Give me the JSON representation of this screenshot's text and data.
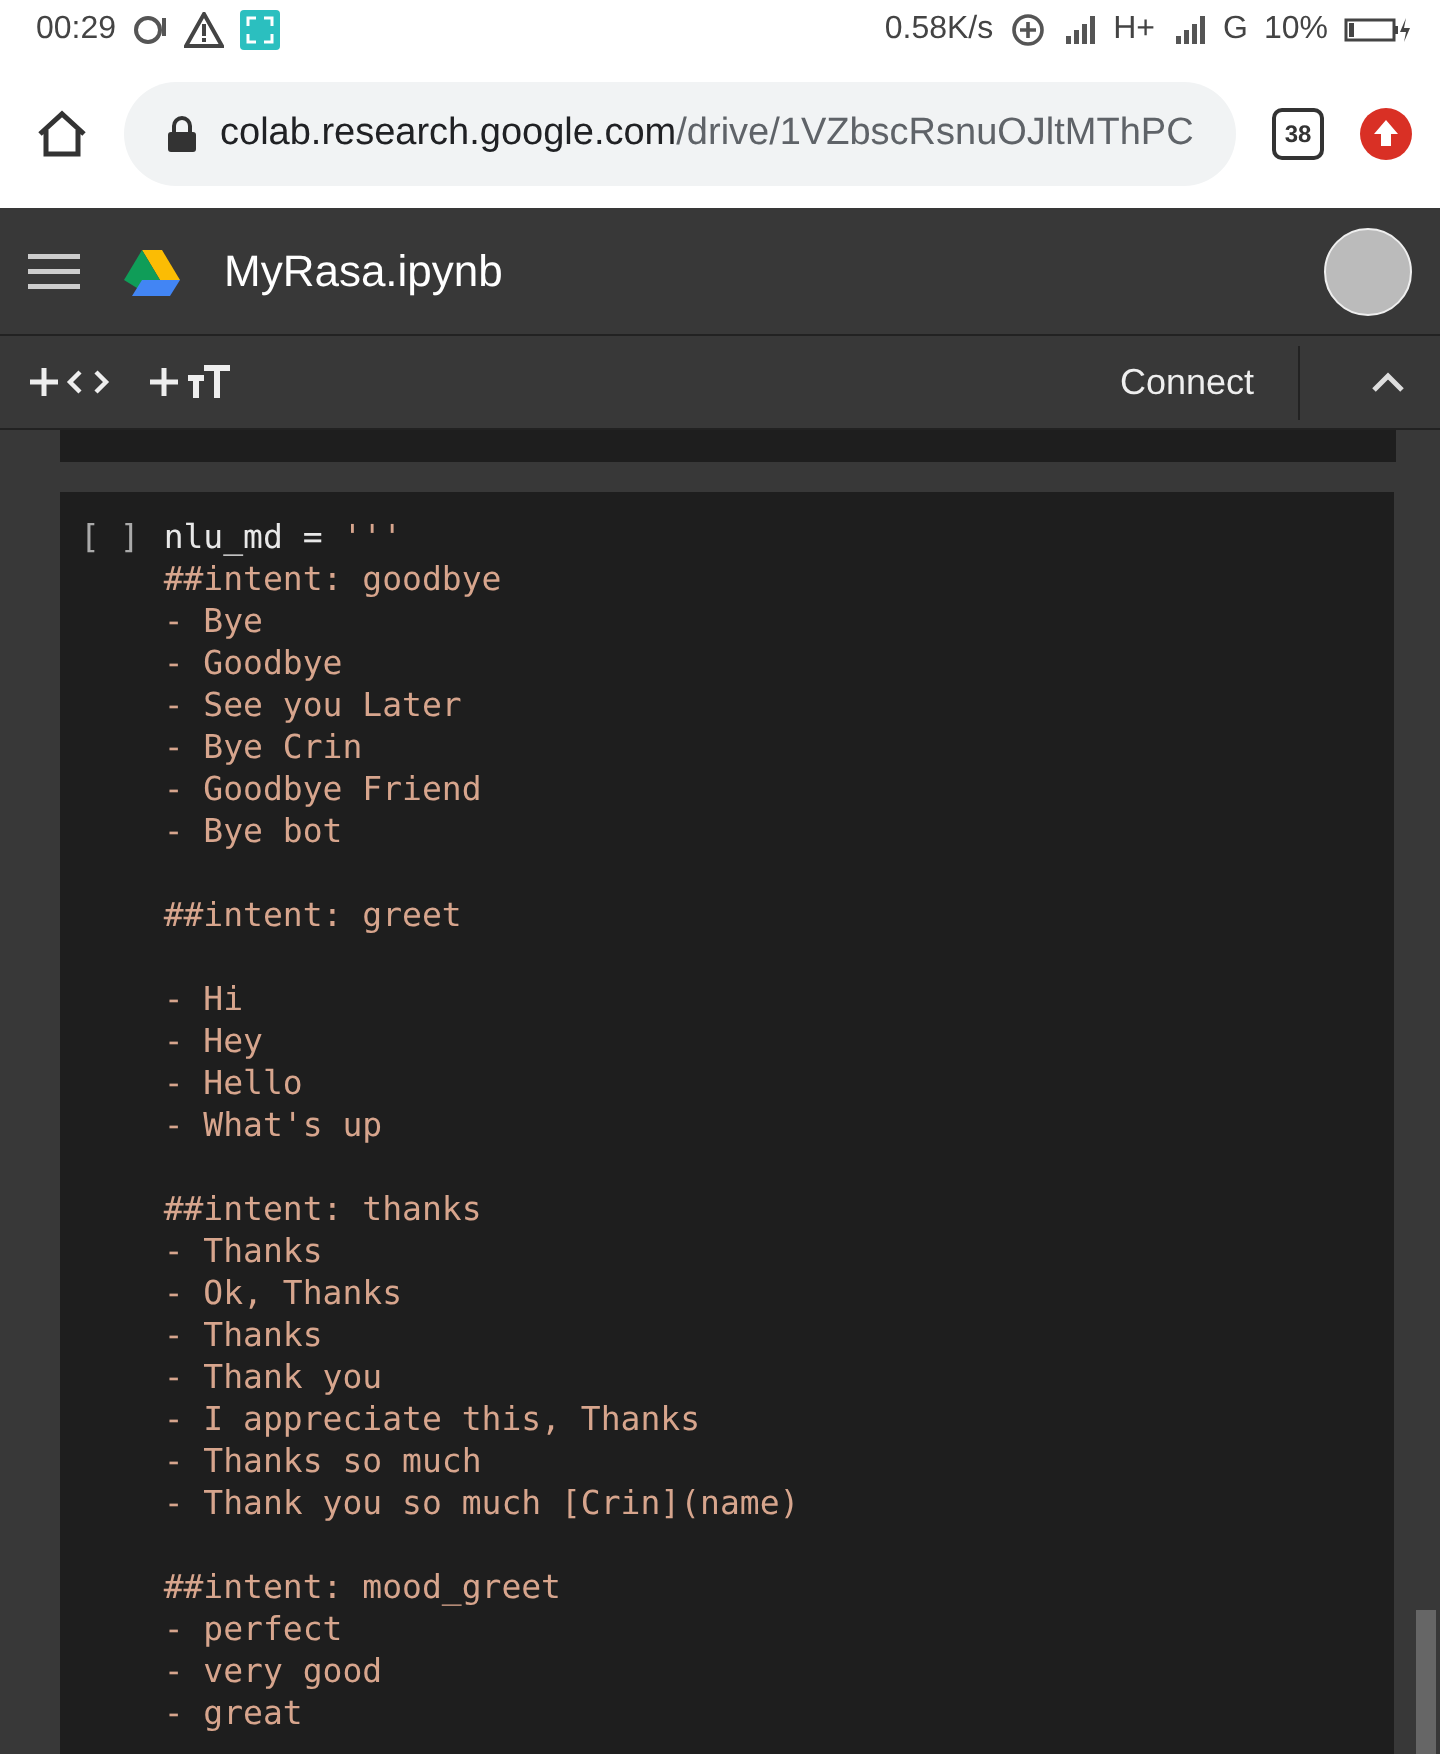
{
  "status_bar": {
    "time": "00:29",
    "speed": "0.58K/s",
    "network_1": "H+",
    "network_2": "G",
    "battery": "10%"
  },
  "browser": {
    "url_host": "colab.research.google.com",
    "url_path": "/drive/1VZbscRsnuOJltMThPC",
    "tab_count": "38"
  },
  "header": {
    "title": "MyRasa.ipynb"
  },
  "toolbar": {
    "connect": "Connect"
  },
  "cell": {
    "run_label": "[ ]",
    "first_line": {
      "name": "nlu_md",
      "operator": "=",
      "string": "'''"
    },
    "lines": [
      {
        "kind": "text",
        "text": "##intent: goodbye"
      },
      {
        "kind": "text",
        "text": "- Bye"
      },
      {
        "kind": "text",
        "text": "- Goodbye"
      },
      {
        "kind": "text",
        "text": "- See you Later"
      },
      {
        "kind": "text",
        "text": "- Bye Crin"
      },
      {
        "kind": "text",
        "text": "- Goodbye Friend"
      },
      {
        "kind": "text",
        "text": "- Bye bot"
      },
      {
        "kind": "blank"
      },
      {
        "kind": "text",
        "text": "##intent: greet"
      },
      {
        "kind": "blank"
      },
      {
        "kind": "text",
        "text": "- Hi"
      },
      {
        "kind": "text",
        "text": "- Hey"
      },
      {
        "kind": "text",
        "text": "- Hello"
      },
      {
        "kind": "text",
        "text": "- What's up"
      },
      {
        "kind": "blank"
      },
      {
        "kind": "text",
        "text": "##intent: thanks"
      },
      {
        "kind": "text",
        "text": "- Thanks"
      },
      {
        "kind": "text",
        "text": "- Ok, Thanks"
      },
      {
        "kind": "text",
        "text": "- Thanks"
      },
      {
        "kind": "text",
        "text": "- Thank you"
      },
      {
        "kind": "text",
        "text": "- I appreciate this, Thanks"
      },
      {
        "kind": "text",
        "text": "- Thanks so much"
      },
      {
        "kind": "text",
        "text": "- Thank you so much [Crin](name)"
      },
      {
        "kind": "blank"
      },
      {
        "kind": "text",
        "text": "##intent: mood_greet"
      },
      {
        "kind": "text",
        "text": "- perfect"
      },
      {
        "kind": "text",
        "text": "- very good"
      },
      {
        "kind": "text",
        "text": "- great"
      }
    ]
  }
}
